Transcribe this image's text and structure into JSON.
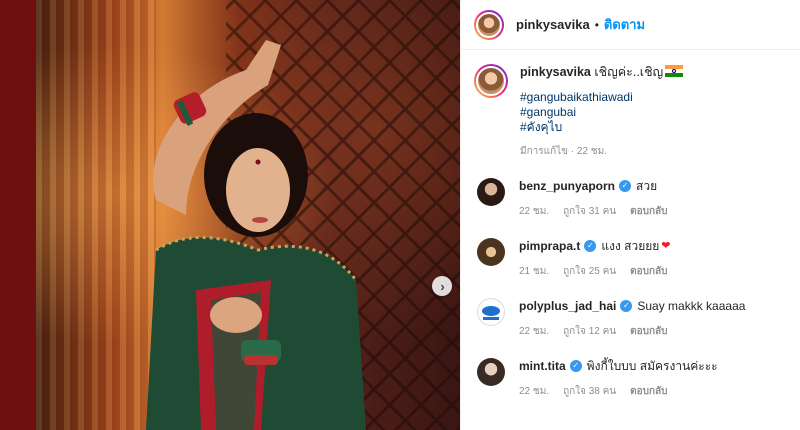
{
  "post": {
    "author": "pinkysavika",
    "follow_label": "ติดตาม",
    "separator": "•",
    "next_arrow_label": "›"
  },
  "caption": {
    "author": "pinkysavika",
    "text": "เชิญค่ะ..เชิญ",
    "hashtags": [
      "#gangubaikathiawadi",
      "#gangubai",
      "#คังคุไบ"
    ],
    "meta": "มีการแก้ไข · 22 ชม."
  },
  "comments": [
    {
      "username": "benz_punyaporn",
      "verified": true,
      "text": "สวย",
      "time": "22 ชม.",
      "likes": "ถูกใจ 31 คน",
      "reply": "ตอบกลับ",
      "heart": ""
    },
    {
      "username": "pimprapa.t",
      "verified": true,
      "text": "แงง สวยยย",
      "time": "21 ชม.",
      "likes": "ถูกใจ 25 คน",
      "reply": "ตอบกลับ",
      "heart": "❤"
    },
    {
      "username": "polyplus_jad_hai",
      "verified": true,
      "text": "Suay makkk kaaaaa",
      "time": "22 ชม.",
      "likes": "ถูกใจ 12 คน",
      "reply": "ตอบกลับ",
      "heart": ""
    },
    {
      "username": "mint.tita",
      "verified": true,
      "text": "พิงกี้ใบบบ สมัครงานค่ะะะ",
      "time": "22 ชม.",
      "likes": "ถูกใจ 38 คน",
      "reply": "ตอบกลับ",
      "heart": ""
    }
  ],
  "colors": {
    "accent": "#0095f6",
    "hashtag": "#00376b",
    "verified": "#3897f0",
    "backdrop": "#6e1010"
  }
}
